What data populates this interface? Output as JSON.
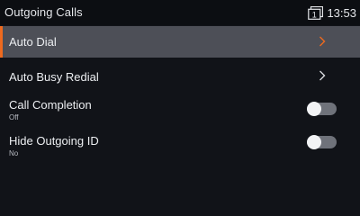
{
  "header": {
    "title": "Outgoing Calls",
    "line_icon": "line-1-icon",
    "line_number": "1",
    "time": "13:53"
  },
  "menu": {
    "items": [
      {
        "label": "Auto Dial",
        "selected": true,
        "type": "submenu",
        "icon": "chevron-right-icon"
      },
      {
        "label": "Auto Busy Redial",
        "selected": false,
        "type": "submenu",
        "icon": "chevron-right-icon"
      },
      {
        "label": "Call Completion",
        "value": "Off",
        "type": "toggle",
        "on": false
      },
      {
        "label": "Hide Outgoing ID",
        "value": "No",
        "type": "toggle",
        "on": false
      }
    ]
  },
  "colors": {
    "background": "#111318",
    "statusbar": "#0c0e12",
    "selected_row": "#4d4f57",
    "accent": "#ee6a1f",
    "toggle_off_track": "#6f727a",
    "toggle_knob": "#f2f3f5"
  }
}
